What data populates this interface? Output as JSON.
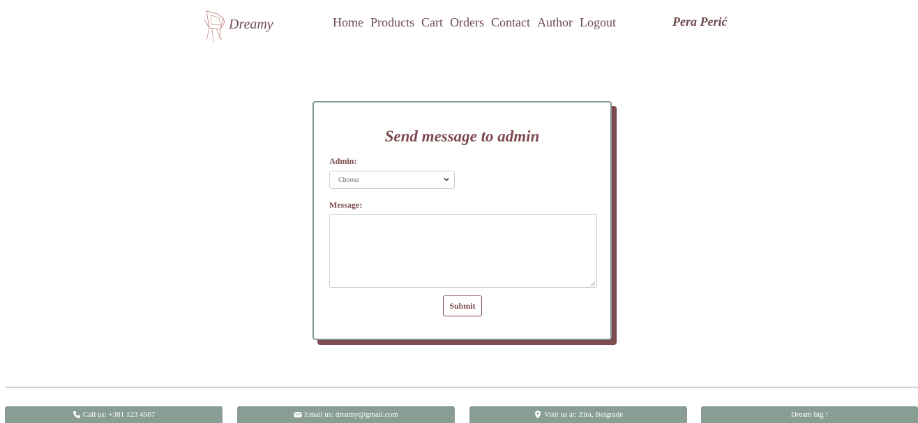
{
  "header": {
    "brand": "Dreamy",
    "nav": [
      "Home",
      "Products",
      "Cart",
      "Orders",
      "Contact",
      "Author",
      "Logout"
    ],
    "user_name": "Pera Perić"
  },
  "form": {
    "title": "Send message to admin",
    "admin_label": "Admin:",
    "admin_selected": "Choose",
    "message_label": "Message:",
    "message_value": "",
    "submit_label": "Submit"
  },
  "footer": {
    "call": "Call us: +381 123 4567",
    "email": "Email us: dreamy@gmail.com",
    "visit": "Visit us at: Zira, Belgrade",
    "slogan": "Dream big !"
  },
  "icons": {
    "logo": "chair-icon",
    "call": "phone-icon",
    "email": "envelope-icon",
    "visit": "map-marker-icon"
  },
  "colors": {
    "accent": "#7d4a4e",
    "border_green": "#7f9690",
    "footer_bg": "#889e95"
  }
}
